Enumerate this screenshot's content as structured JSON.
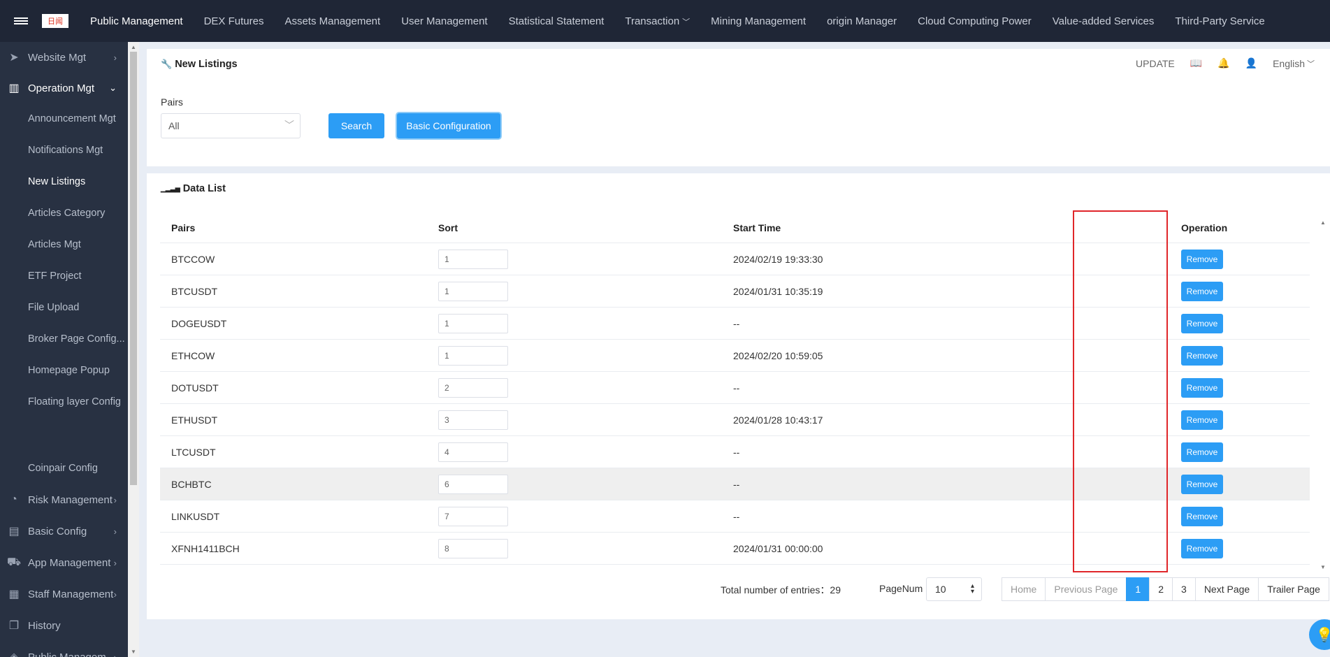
{
  "logo_text": "日闻",
  "topnav": {
    "items": [
      {
        "label": "Public Management"
      },
      {
        "label": "DEX Futures"
      },
      {
        "label": "Assets Management"
      },
      {
        "label": "User Management"
      },
      {
        "label": "Statistical Statement"
      },
      {
        "label": "Transaction"
      },
      {
        "label": "Mining Management"
      },
      {
        "label": "origin Manager"
      },
      {
        "label": "Cloud Computing Power"
      },
      {
        "label": "Value-added Services"
      },
      {
        "label": "Third-Party Service"
      }
    ]
  },
  "sidebar": {
    "website_mgt": "Website Mgt",
    "operation_mgt": "Operation Mgt",
    "sub_items": [
      "Announcement Mgt",
      "Notifications Mgt",
      "New Listings",
      "Articles Category",
      "Articles Mgt",
      "ETF Project",
      "File Upload",
      "Broker Page Config...",
      "Homepage Popup",
      "Floating layer Config",
      "Coinpair Config"
    ],
    "risk_management": "Risk Management",
    "basic_config": "Basic Config",
    "app_management": "App Management",
    "staff_management": "Staff Management",
    "history": "History",
    "public_management": "Public Managem..."
  },
  "header": {
    "update": "UPDATE",
    "language": "English"
  },
  "filter_panel": {
    "title": "New Listings",
    "pairs_label": "Pairs",
    "pairs_value": "All",
    "search_label": "Search",
    "basic_config_label": "Basic Configuration"
  },
  "list_panel": {
    "title": "Data List",
    "columns": [
      "Pairs",
      "Sort",
      "Start Time",
      "Operation"
    ],
    "remove_label": "Remove",
    "rows": [
      {
        "pair": "BTCCOW",
        "sort": "1",
        "start_time": "2024/02/19 19:33:30"
      },
      {
        "pair": "BTCUSDT",
        "sort": "1",
        "start_time": "2024/01/31 10:35:19"
      },
      {
        "pair": "DOGEUSDT",
        "sort": "1",
        "start_time": "--"
      },
      {
        "pair": "ETHCOW",
        "sort": "1",
        "start_time": "2024/02/20 10:59:05"
      },
      {
        "pair": "DOTUSDT",
        "sort": "2",
        "start_time": "--"
      },
      {
        "pair": "ETHUSDT",
        "sort": "3",
        "start_time": "2024/01/28 10:43:17"
      },
      {
        "pair": "LTCUSDT",
        "sort": "4",
        "start_time": "--"
      },
      {
        "pair": "BCHBTC",
        "sort": "6",
        "start_time": "--"
      },
      {
        "pair": "LINKUSDT",
        "sort": "7",
        "start_time": "--"
      },
      {
        "pair": "XFNH1411BCH",
        "sort": "8",
        "start_time": "2024/01/31 00:00:00"
      }
    ]
  },
  "pagination": {
    "total_label": "Total number of entries：29",
    "pagenum_label": "PageNum",
    "pagenum_value": "10",
    "home": "Home",
    "previous": "Previous Page",
    "pages": [
      "1",
      "2",
      "3"
    ],
    "next": "Next Page",
    "trailer": "Trailer Page"
  },
  "colors": {
    "primary": "#2c9df5",
    "highlight_box": "#e0262a",
    "topnav_bg": "#1f2636",
    "sidebar_bg": "#283142"
  }
}
